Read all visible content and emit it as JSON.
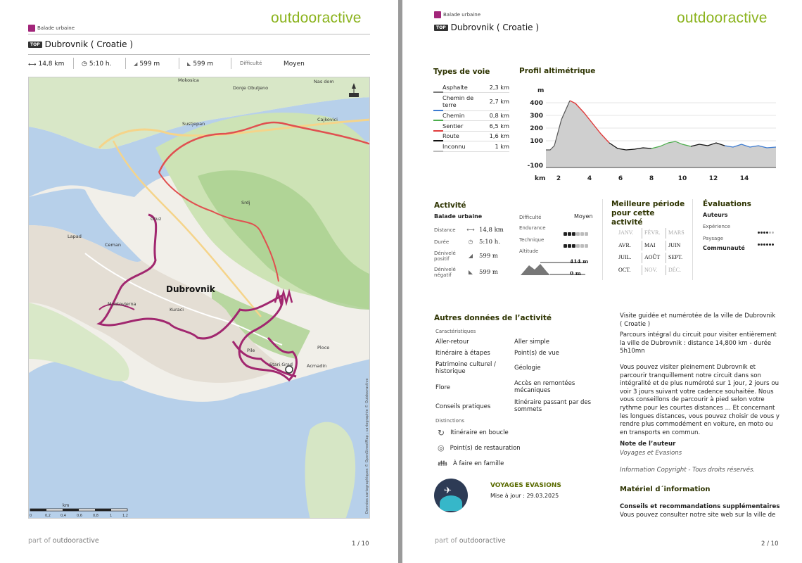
{
  "brand": "outdooractive",
  "page1": {
    "category": "Balade urbaine",
    "top_badge": "TOP",
    "title": "Dubrovnik ( Croatie )",
    "stats": {
      "distance": "14,8 km",
      "duration": "5:10 h.",
      "ascent": "599 m",
      "descent": "599 m",
      "difficulty_label": "Difficulté",
      "difficulty_value": "Moyen"
    },
    "map": {
      "places": [
        "Mokosica",
        "Donje Obuljeno",
        "Nas dom",
        "Cajkovici",
        "Sustjepan",
        "Gruz",
        "Lapad",
        "Ceman",
        "Dubrovnik",
        "Montovjerna",
        "Kuraci",
        "Pile",
        "Stari Grad",
        "Ploce",
        "Acmadin",
        "Srdj"
      ],
      "scale": [
        "0",
        "0,2",
        "0,4",
        "0,6",
        "0,8",
        "1",
        "1,2"
      ],
      "scale_unit": "km",
      "copyright": "Données cartographiques © OpenStreetMap ; cartographie © Outdooractive"
    },
    "footer_prefix": "part of",
    "footer_brand": "outdooractive",
    "page_number": "1 / 10"
  },
  "page2": {
    "category": "Balade urbaine",
    "top_badge": "TOP",
    "title": "Dubrovnik ( Croatie )",
    "surface_title": "Types de voie",
    "surfaces": [
      {
        "name": "Asphalte",
        "value": "2,3 km",
        "color": "#7a7a7a"
      },
      {
        "name": "Chemin de terre",
        "value": "2,7 km",
        "color": "#3c7bd1"
      },
      {
        "name": "Chemin",
        "value": "0,8 km",
        "color": "#4cae4c"
      },
      {
        "name": "Sentier",
        "value": "6,5 km",
        "color": "#e03b3b"
      },
      {
        "name": "Route",
        "value": "1,6 km",
        "color": "#111111"
      },
      {
        "name": "Inconnu",
        "value": "1 km",
        "color": "#bbbbbb"
      }
    ],
    "profile": {
      "title": "Profil altimétrique",
      "y_unit": "m",
      "x_unit": "km",
      "y_ticks": [
        "400",
        "300",
        "200",
        "100",
        "-100"
      ],
      "x_ticks": [
        "2",
        "4",
        "6",
        "8",
        "10",
        "12",
        "14"
      ]
    },
    "activity": {
      "title": "Activité",
      "type": "Balade urbaine",
      "rows": [
        {
          "label": "Distance",
          "value": "14,8  km"
        },
        {
          "label": "Durée",
          "value": "5:10  h."
        },
        {
          "label": "Dénivelé positif",
          "value": "599  m"
        },
        {
          "label": "Dénivelé négatif",
          "value": "599  m"
        }
      ],
      "difficulty_label": "Difficulté",
      "difficulty_value": "Moyen",
      "endurance_label": "Endurance",
      "endurance_level": 3,
      "technique_label": "Technique",
      "technique_level": 3,
      "altitude_label": "Altitude",
      "alt_max": "414 m",
      "alt_min": "0 m"
    },
    "season": {
      "title": "Meilleure période pour cette activité",
      "months": [
        {
          "m": "JANV.",
          "on": false
        },
        {
          "m": "FÉVR.",
          "on": false
        },
        {
          "m": "MARS",
          "on": false
        },
        {
          "m": "AVR.",
          "on": true
        },
        {
          "m": "MAI",
          "on": true
        },
        {
          "m": "JUIN",
          "on": true
        },
        {
          "m": "JUIL.",
          "on": true
        },
        {
          "m": "AOÛT",
          "on": true
        },
        {
          "m": "SEPT.",
          "on": true
        },
        {
          "m": "OCT.",
          "on": true
        },
        {
          "m": "NOV.",
          "on": false
        },
        {
          "m": "DÉC.",
          "on": false
        }
      ]
    },
    "ratings": {
      "title": "Évaluations",
      "authors": "Auteurs",
      "experience_label": "Expérience",
      "experience_level": 4,
      "landscape_label": "Paysage",
      "landscape_level": 6,
      "community": "Communauté"
    },
    "other": {
      "title": "Autres données de l’activité",
      "characteristics_label": "Caractéristiques",
      "features_left": [
        "Aller-retour",
        "Itinéraire à étapes",
        "Patrimoine culturel / historique",
        "Flore",
        "Conseils pratiques"
      ],
      "features_right": [
        "Aller simple",
        "Point(s) de vue",
        "Géologie",
        "Accès en remontées mécaniques",
        "Itinéraire passant par des sommets"
      ],
      "distinctions_label": "Distinctions",
      "distinctions": [
        "Itinéraire en boucle",
        "Point(s) de restauration",
        "À faire en famille"
      ]
    },
    "author_box": {
      "name": "VOYAGES EVASIONS",
      "update": "Mise à jour : 29.03.2025"
    },
    "description": {
      "heading": "Visite guidée et numérotée de la ville de Dubrovnik ( Croatie )",
      "p1": "Parcours intégral du circuit pour visiter entièrement la ville de Dubrovnik : distance 14,800 km - durée 5h10mn",
      "p2": "Vous pouvez visiter pleinement Dubrovnik et parcourir tranquillement notre circuit dans son intégralité et de plus numéroté sur 1 jour, 2 jours ou voir 3 jours suivant votre cadence souhaitée. Nous vous conseillons de parcourir à pied selon votre rythme pour les courtes distances ... Et concernant les longues distances, vous pouvez choisir de vous y rendre plus commodément en voiture, en moto ou en transports en commun.",
      "author_note_title": "Note de l’auteur",
      "author_note_1": "Voyages et Evasions",
      "author_note_2": "Information Copyright - Tous droits réservés.",
      "info_title": "Matériel d´information",
      "tips_title": "Conseils et recommandations supplémentaires",
      "tips_text": "Vous pouvez consulter notre site web sur la ville de"
    },
    "footer_prefix": "part of",
    "footer_brand": "outdooractive",
    "page_number": "2 / 10"
  }
}
